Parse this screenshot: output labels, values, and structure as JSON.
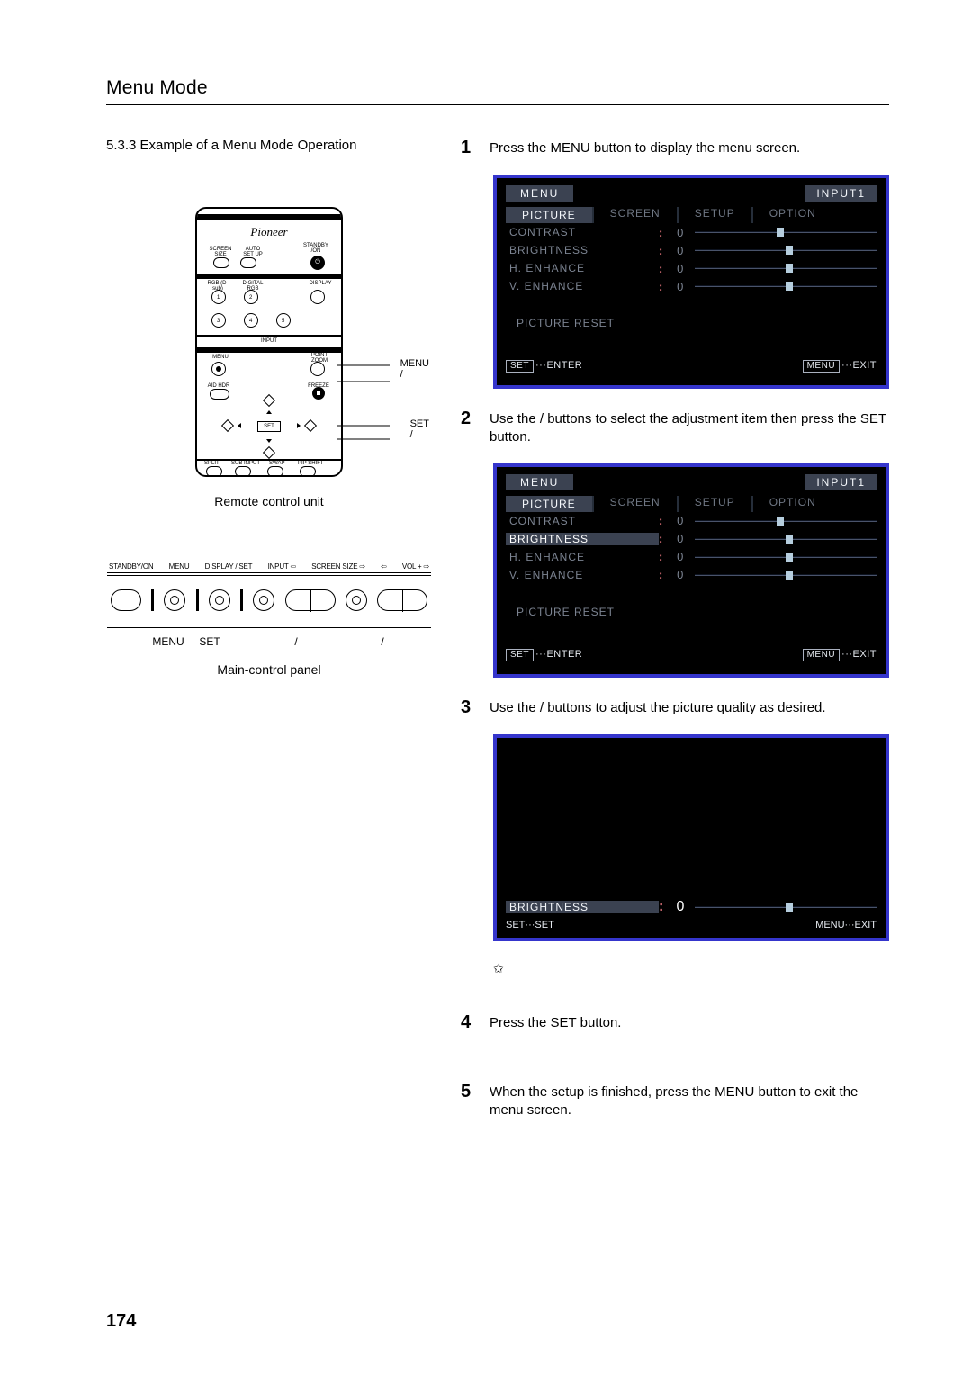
{
  "page": {
    "title": "Menu Mode",
    "number": "174",
    "subsection": "5.3.3 Example of a Menu Mode Operation"
  },
  "left": {
    "remote_brand": "Pioneer",
    "remote_caption": "Remote control unit",
    "remote_labels": {
      "menu": "MENU",
      "slash1": "/",
      "set": "SET",
      "slash2": "/"
    },
    "remote_buttons": {
      "screen_size": "SCREEN SIZE",
      "auto_setup": "AUTO SET UP",
      "standby_on": "STANDBY /ON",
      "rgb": "RGB (D-sub)",
      "digital_rgb": "DIGITAL RGB",
      "display": "DISPLAY",
      "input": "INPUT",
      "n1": "1",
      "n2": "2",
      "n3": "3",
      "n4": "4",
      "n5": "5",
      "menu": "MENU",
      "point_zoom": "POINT ZOOM",
      "aid_hdr": "AID HDR",
      "freeze": "FREEZE",
      "set": "SET",
      "split": "SPLIT",
      "subinput": "SUB INPUT",
      "swap": "SWAP",
      "pipshift": "PIP SHIFT"
    },
    "panel_caption": "Main-control panel",
    "panel_top_labels": [
      "STANDBY/ON",
      "MENU",
      "DISPLAY / SET",
      "INPUT ⇦",
      "SCREEN SIZE ⇨",
      "⇦",
      "VOL + ⇨"
    ],
    "panel_bottom_labels": [
      "MENU",
      "SET",
      "/",
      "/"
    ]
  },
  "steps": {
    "s1": {
      "num": "1",
      "text": "Press the MENU button to display the menu screen."
    },
    "s2": {
      "num": "2",
      "text": "Use the    /    buttons to select the adjustment item then press the SET button."
    },
    "s3": {
      "num": "3",
      "text": "Use the    /    buttons to adjust the picture quality as desired."
    },
    "s4": {
      "num": "4",
      "text": "Press the SET button."
    },
    "s5": {
      "num": "5",
      "text": "When the setup is finished, press the MENU button to exit the menu screen."
    }
  },
  "star": "✩",
  "osd": {
    "menu_label": "MENU",
    "input_label": "INPUT1",
    "tabs": [
      "PICTURE",
      "SCREEN",
      "SETUP",
      "OPTION"
    ],
    "items": [
      {
        "name": "CONTRAST",
        "value": "0",
        "slider": "contrast"
      },
      {
        "name": "BRIGHTNESS",
        "value": "0",
        "slider": "center"
      },
      {
        "name": "H. ENHANCE",
        "value": "0",
        "slider": "center"
      },
      {
        "name": "V. ENHANCE",
        "value": "0",
        "slider": "center"
      }
    ],
    "reset": "PICTURE RESET",
    "footer_enter": {
      "key": "SET",
      "label": "ENTER"
    },
    "footer_exit": {
      "key": "MENU",
      "label": "EXIT"
    },
    "footer_set": {
      "key": "SET",
      "label": "SET"
    }
  },
  "osd3_item": {
    "name": "BRIGHTNESS",
    "value": "0"
  }
}
